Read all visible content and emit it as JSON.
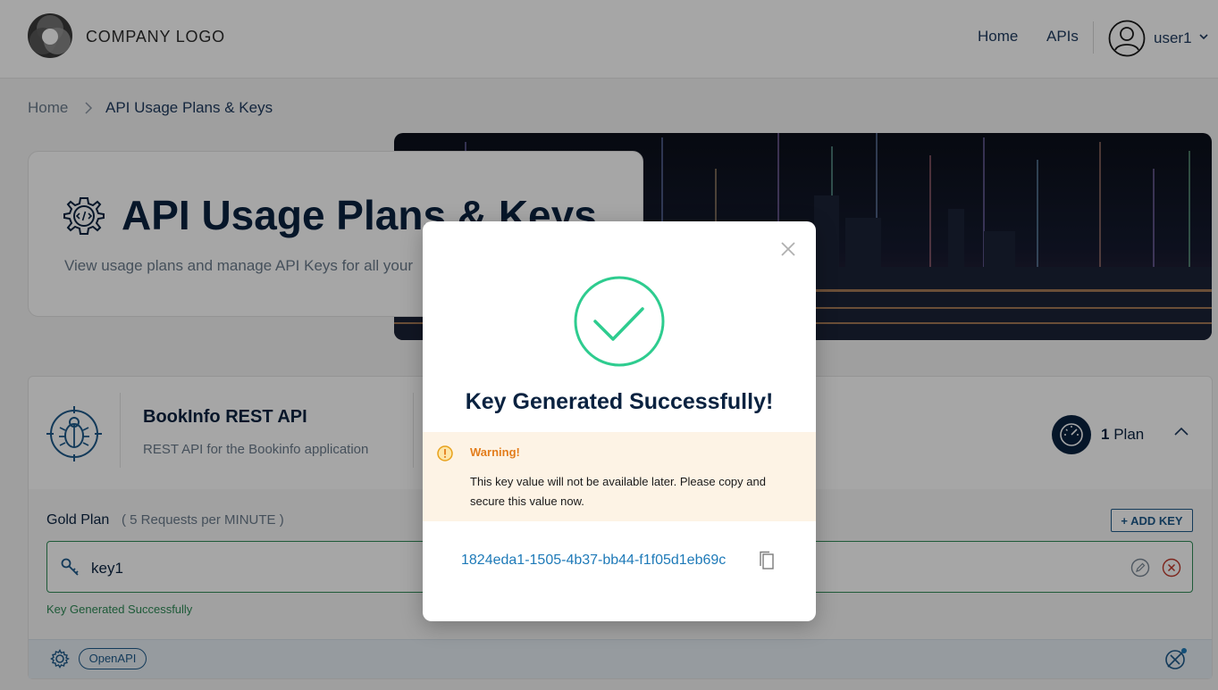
{
  "header": {
    "logo_text": "COMPANY LOGO",
    "nav": {
      "home": "Home",
      "apis": "APIs"
    },
    "user": {
      "name": "user1"
    }
  },
  "breadcrumb": {
    "home": "Home",
    "current": "API Usage Plans & Keys"
  },
  "page": {
    "title": "API Usage Plans & Keys",
    "subtitle": "View usage plans and manage API Keys for all your"
  },
  "api_card": {
    "name": "BookInfo REST API",
    "description": "REST API for the Bookinfo application",
    "plan_count": "1",
    "plan_label": "Plan",
    "plan": {
      "name": "Gold Plan",
      "rate": "( 5 Requests per MINUTE )",
      "add_key_label": "+ ADD KEY"
    },
    "key": {
      "name": "key1",
      "status": "Key Generated Successfully"
    },
    "footer": {
      "badge": "OpenAPI"
    }
  },
  "modal": {
    "title": "Key Generated Successfully!",
    "warning_title": "Warning!",
    "warning_text": "This key value will not be available later. Please copy and secure this value now.",
    "key_value": "1824eda1-1505-4b37-bb44-f1f05d1eb69c"
  },
  "colors": {
    "primary": "#0a2240",
    "success": "#2ecc8f",
    "warning": "#e37d1c",
    "warning_bg": "#fdf3e5",
    "link": "#1e7ab8",
    "key_border": "#2e8b57",
    "delete": "#c0392b"
  },
  "icons": {
    "logo": "company-logo-icon",
    "user": "user-avatar-icon",
    "title": "settings-code-icon",
    "api": "bug-api-icon",
    "plan": "speedometer-icon",
    "key": "key-icon",
    "edit": "edit-icon",
    "delete": "delete-icon",
    "modal_close": "close-icon",
    "success": "check-circle-icon",
    "warning": "warning-icon",
    "copy": "copy-icon"
  }
}
